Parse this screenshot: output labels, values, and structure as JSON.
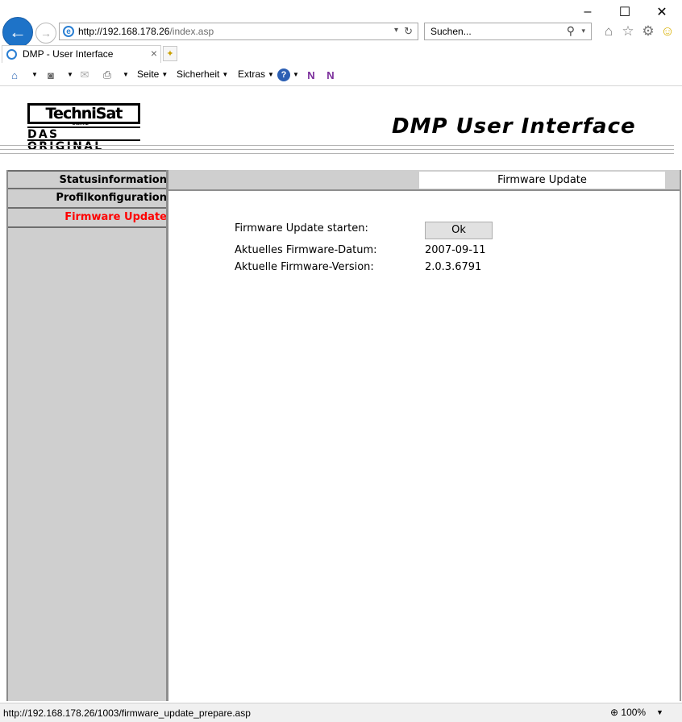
{
  "window": {
    "controls": [
      "–",
      "☐",
      "✕"
    ]
  },
  "navbar": {
    "url_host": "http://192.168.178.26",
    "url_path": "/index.asp",
    "search_placeholder": "Suchen..."
  },
  "tab": {
    "title": "DMP - User Interface"
  },
  "commandbar": {
    "seite": "Seite",
    "sicherheit": "Sicherheit",
    "extras": "Extras"
  },
  "header": {
    "logo_line1": "TechniSat",
    "logo_digital": "DIGITAL",
    "logo_line2": "DAS ORIGINAL",
    "title": "DMP User Interface"
  },
  "sidebar": {
    "items": [
      {
        "label": "Statusinformation",
        "color": "#000000"
      },
      {
        "label": "Profilkonfiguration",
        "color": "#000000"
      },
      {
        "label": "Firmware Update",
        "color": "#ff0000"
      }
    ]
  },
  "main": {
    "heading": "Firmware Update",
    "rows": [
      {
        "label": "Firmware Update starten:",
        "button": "Ok"
      },
      {
        "label": "Aktuelles Firmware-Datum:",
        "value": "2007-09-11"
      },
      {
        "label": "Aktuelle Firmware-Version:",
        "value": "2.0.3.6791"
      }
    ]
  },
  "statusbar": {
    "url": "http://192.168.178.26/1003/firmware_update_prepare.asp",
    "zoom": "100%"
  }
}
